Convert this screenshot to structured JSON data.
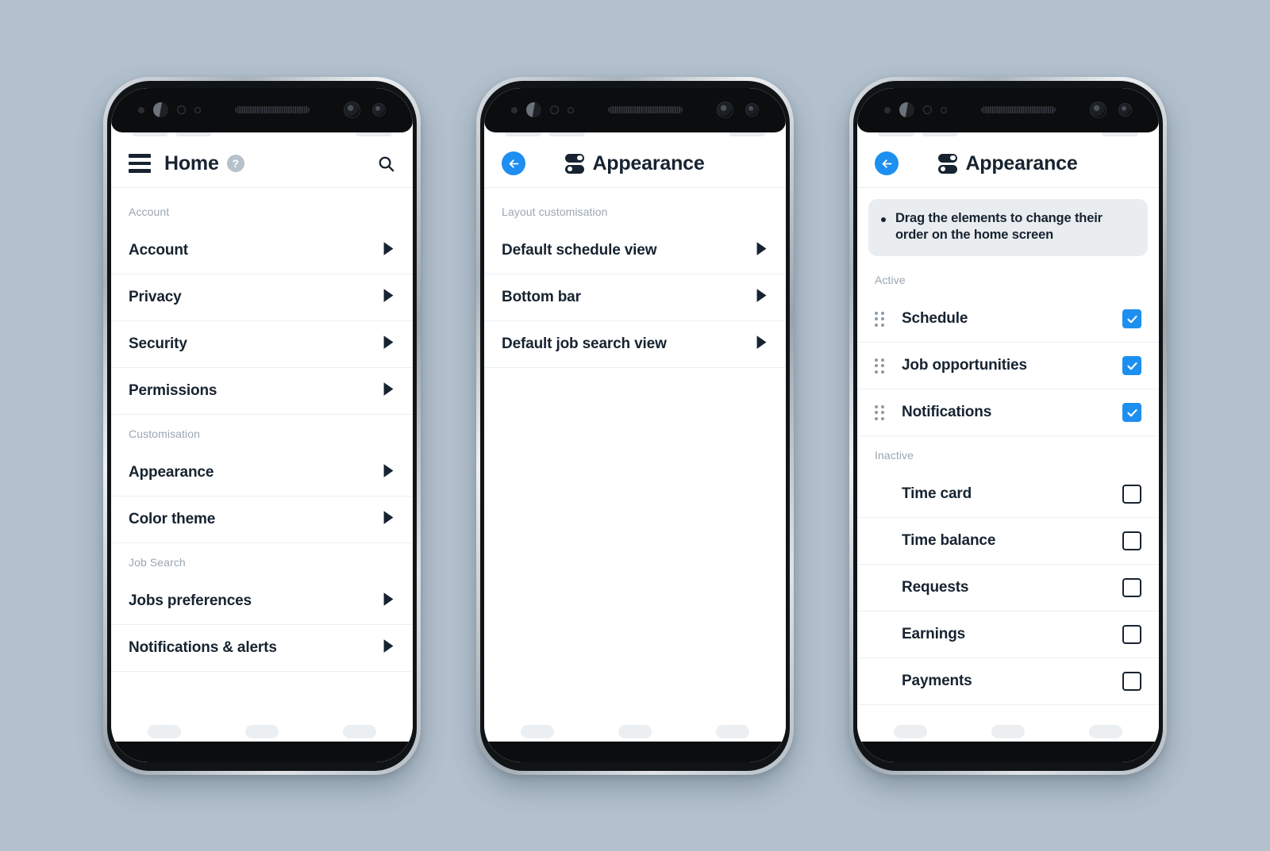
{
  "background_color": "#b3c1ce",
  "accent_color": "#1d8ff0",
  "text_color": "#172330",
  "muted_color": "#9aa6b1",
  "phones": [
    {
      "id": "phone-home-settings",
      "header": {
        "menu_icon": "hamburger-icon",
        "title": "Home",
        "help_icon": "help-circle-icon",
        "help_glyph": "?",
        "search_icon": "search-icon"
      },
      "groups": [
        {
          "label": "Account",
          "rows": [
            {
              "label": "Account",
              "chevron": "chevron-right-icon"
            },
            {
              "label": "Privacy",
              "chevron": "chevron-right-icon"
            },
            {
              "label": "Security",
              "chevron": "chevron-right-icon"
            },
            {
              "label": "Permissions",
              "chevron": "chevron-right-icon"
            }
          ]
        },
        {
          "label": "Customisation",
          "rows": [
            {
              "label": "Appearance",
              "chevron": "chevron-right-icon"
            },
            {
              "label": "Color theme",
              "chevron": "chevron-right-icon"
            }
          ]
        },
        {
          "label": "Job Search",
          "rows": [
            {
              "label": "Jobs preferences",
              "chevron": "chevron-right-icon"
            },
            {
              "label": "Notifications & alerts",
              "chevron": "chevron-right-icon"
            }
          ]
        }
      ]
    },
    {
      "id": "phone-appearance-layout",
      "header": {
        "back_icon": "arrow-left-icon",
        "title_icon": "toggles-icon",
        "title": "Appearance"
      },
      "groups": [
        {
          "label": "Layout customisation",
          "rows": [
            {
              "label": "Default schedule view",
              "chevron": "chevron-right-icon"
            },
            {
              "label": "Bottom bar",
              "chevron": "chevron-right-icon"
            },
            {
              "label": "Default job search view",
              "chevron": "chevron-right-icon"
            }
          ]
        }
      ]
    },
    {
      "id": "phone-appearance-bottombar",
      "header": {
        "back_icon": "arrow-left-icon",
        "title_icon": "toggles-icon",
        "title": "Appearance"
      },
      "banner": {
        "bullet": "•",
        "text": "Drag the elements to change their order on the home screen"
      },
      "sections": [
        {
          "label": "Active",
          "items": [
            {
              "label": "Schedule",
              "checked": true,
              "draggable": true
            },
            {
              "label": "Job opportunities",
              "checked": true,
              "draggable": true
            },
            {
              "label": "Notifications",
              "checked": true,
              "draggable": true
            }
          ]
        },
        {
          "label": "Inactive",
          "items": [
            {
              "label": "Time card",
              "checked": false,
              "draggable": false
            },
            {
              "label": "Time balance",
              "checked": false,
              "draggable": false
            },
            {
              "label": "Requests",
              "checked": false,
              "draggable": false
            },
            {
              "label": "Earnings",
              "checked": false,
              "draggable": false
            },
            {
              "label": "Payments",
              "checked": false,
              "draggable": false
            }
          ]
        }
      ]
    }
  ]
}
